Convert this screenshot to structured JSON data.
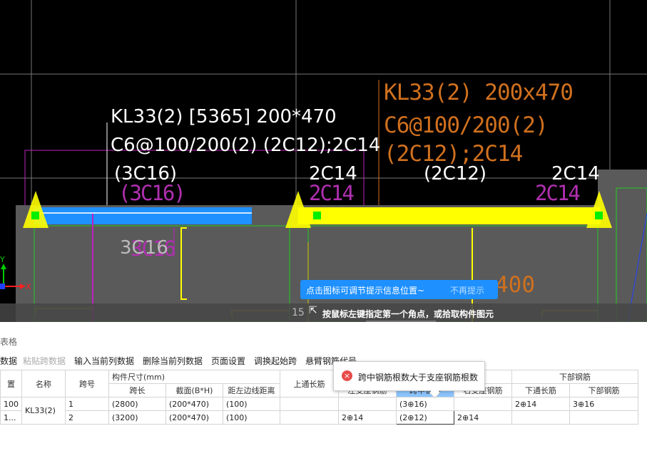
{
  "cad": {
    "left_label": {
      "line1": "KL33(2) [5365] 200*470",
      "line2": "C6@100/200(2) (2C12);2C14",
      "line3": "(3C16)"
    },
    "right_label": {
      "line1": "KL33(2) 200x470",
      "line2": "C6@100/200(2)",
      "line3": "(2C12);2C14"
    },
    "top_bars": {
      "a": "2C14",
      "b": "(2C12)",
      "c": "2C14"
    },
    "magenta": {
      "a": "(3C16)",
      "b": "2C14",
      "c": "2C14",
      "d": "3C16"
    },
    "grey_3c16": "3C16",
    "bottom_right_text": "400",
    "axis": {
      "y": "Y",
      "x": "X"
    },
    "tip": {
      "text": "点击图标可调节提示信息位置~",
      "dismiss": "不再提示"
    },
    "status": {
      "number": "15",
      "icon": "cursor-icon",
      "text": "按鼠标左键指定第一个角点，或拾取构件图元"
    }
  },
  "panel": {
    "title": "表格",
    "toolbar": [
      "数据",
      "粘贴跨数据",
      "输入当前列数据",
      "删除当前列数据",
      "页面设置",
      "调换起始跨",
      "悬臂钢筋代号"
    ],
    "toolbar_disabled": [
      false,
      true,
      false,
      false,
      false,
      false,
      false
    ],
    "error_popup": "跨中钢筋根数大于支座钢筋根数",
    "header": {
      "c0": "置",
      "name": "名称",
      "span": "跨号",
      "dims": "构件尺寸(mm)",
      "span_len": "跨长",
      "section": "截面(B*H)",
      "edge": "距左边线距离",
      "top_long": "上通长筋",
      "left_seat": "左支座钢筋",
      "mid": "跨中钢筋",
      "right_seat": "右支座钢筋",
      "bottom_group": "下部钢筋",
      "bottom_long": "下通长筋",
      "bottom": "下部钢筋"
    },
    "rows": [
      {
        "c0": "100",
        "name": "KL33(2)",
        "span": "1",
        "len": "(2800)",
        "section": "(200*470)",
        "edge": "(100)",
        "top_long": "",
        "left_seat": "",
        "mid": "(3⊕16)",
        "right_seat": "",
        "bottom_long": "2⊕14",
        "bottom": "3⊕16"
      },
      {
        "c0": "1...",
        "name": "",
        "span": "2",
        "len": "(3200)",
        "section": "(200*470)",
        "edge": "(100)",
        "top_long": "",
        "left_seat": "2⊕14",
        "mid": "(2⊕12)",
        "right_seat": "2⊕14",
        "bottom_long": "",
        "bottom": ""
      }
    ]
  }
}
